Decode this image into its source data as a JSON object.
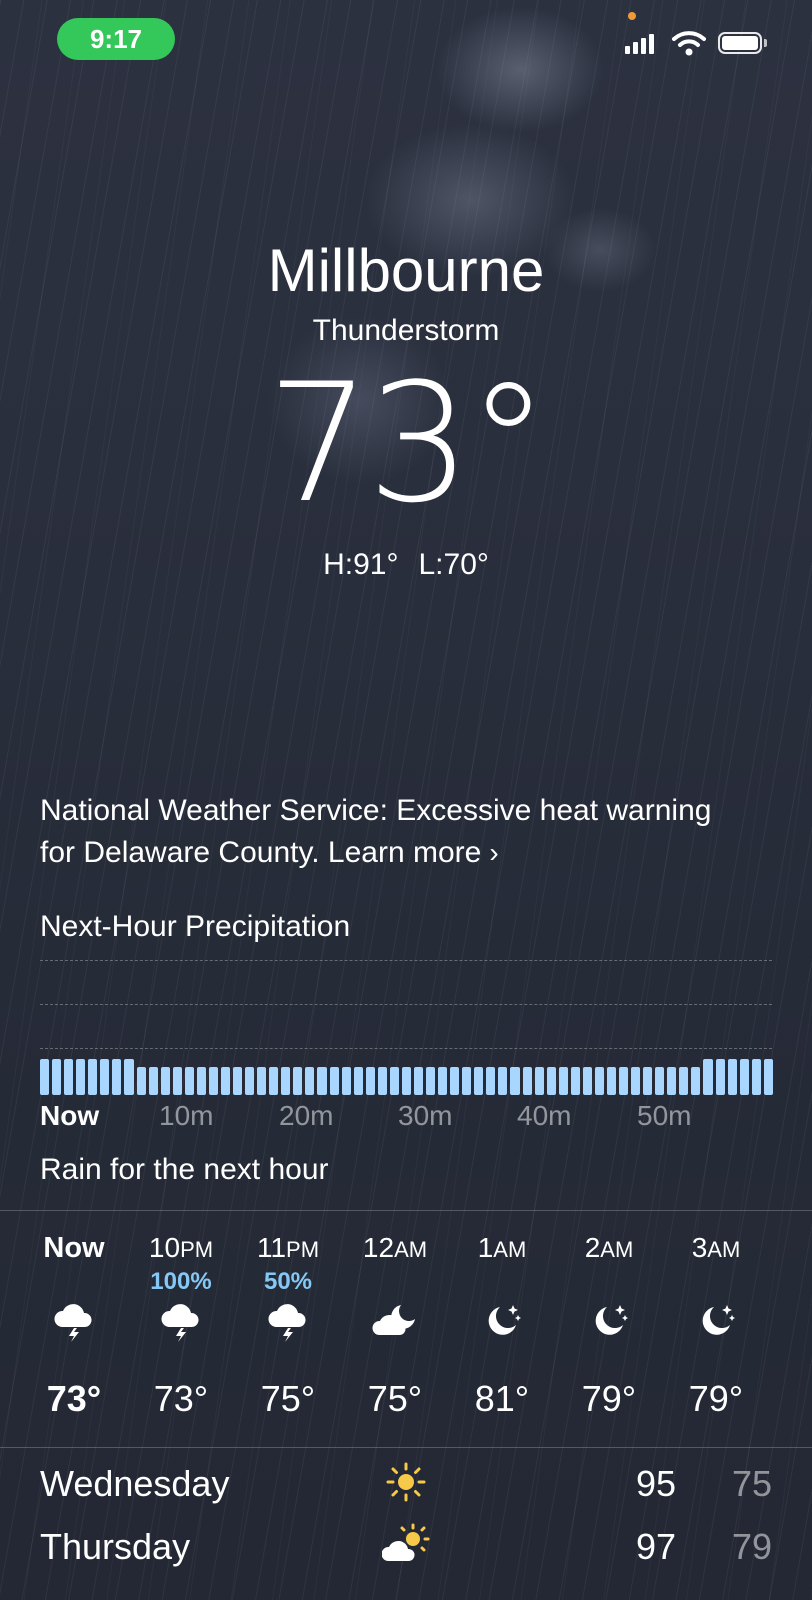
{
  "status_bar": {
    "time": "9:17"
  },
  "header": {
    "city": "Millbourne",
    "condition": "Thunderstorm",
    "temperature": "73°",
    "high": "H:91°",
    "low": "L:70°"
  },
  "alert": {
    "text": "National Weather Service: Excessive heat warning for Delaware County. Learn more",
    "chevron": "›"
  },
  "precipitation": {
    "title": "Next-Hour Precipitation",
    "ticks": [
      "Now",
      "10m",
      "20m",
      "30m",
      "40m",
      "50m"
    ],
    "summary": "Rain for the next hour",
    "bar_color": "#a8d6ff",
    "intensity": "heavy-steady"
  },
  "hourly": [
    {
      "time": "Now",
      "period": "",
      "chance": "",
      "icon": "thunderstorm-icon",
      "temp": "73°"
    },
    {
      "time": "10",
      "period": "PM",
      "chance": "100%",
      "icon": "thunderstorm-icon",
      "temp": "73°"
    },
    {
      "time": "11",
      "period": "PM",
      "chance": "50%",
      "icon": "thunderstorm-icon",
      "temp": "75°"
    },
    {
      "time": "12",
      "period": "AM",
      "chance": "",
      "icon": "partly-cloudy-night-icon",
      "temp": "75°"
    },
    {
      "time": "1",
      "period": "AM",
      "chance": "",
      "icon": "clear-night-icon",
      "temp": "81°"
    },
    {
      "time": "2",
      "period": "AM",
      "chance": "",
      "icon": "clear-night-icon",
      "temp": "79°"
    },
    {
      "time": "3",
      "period": "AM",
      "chance": "",
      "icon": "clear-night-icon",
      "temp": "79°"
    }
  ],
  "daily": [
    {
      "day": "Wednesday",
      "icon": "sunny-icon",
      "high": "95",
      "low": "75"
    },
    {
      "day": "Thursday",
      "icon": "partly-sunny-icon",
      "high": "97",
      "low": "79"
    }
  ],
  "colors": {
    "accent_precip": "#86c8f5",
    "time_pill": "#34c759",
    "sun": "#f7c948"
  }
}
